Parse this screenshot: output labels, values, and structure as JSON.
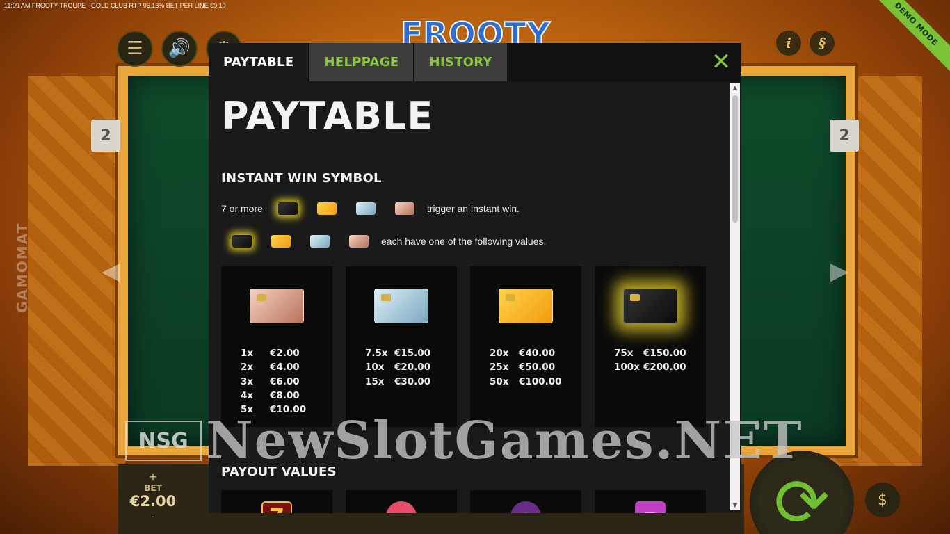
{
  "status_bar": "11:09 AM  FROOTY TROUPE - GOLD CLUB  RTP 96.13%  BET PER LINE €0.10",
  "demo_mode": "DEMO MODE",
  "game_logo": "FROOTY TROUPE",
  "vendor": "GAMOMAT",
  "line_marker_left": "2",
  "line_marker_right": "2",
  "bet": {
    "plus": "+",
    "label": "BET",
    "value": "€2.00",
    "minus": "-"
  },
  "watermark": {
    "badge": "NSG",
    "text": "NewSlotGames.NET"
  },
  "modal": {
    "tabs": [
      {
        "label": "PAYTABLE",
        "active": true
      },
      {
        "label": "HELPPAGE",
        "active": false
      },
      {
        "label": "HISTORY",
        "active": false
      }
    ],
    "close": "✕",
    "page_title": "PAYTABLE",
    "instant_win": {
      "title": "INSTANT WIN SYMBOL",
      "row1_lead": "7 or more",
      "row1_tail": "trigger an instant win.",
      "row2_tail": "each have one of the following values."
    },
    "value_cards": [
      {
        "card": "bronze",
        "rows": [
          {
            "mult": "1x",
            "amt": "€2.00"
          },
          {
            "mult": "2x",
            "amt": "€4.00"
          },
          {
            "mult": "3x",
            "amt": "€6.00"
          },
          {
            "mult": "4x",
            "amt": "€8.00"
          },
          {
            "mult": "5x",
            "amt": "€10.00"
          }
        ]
      },
      {
        "card": "silver",
        "rows": [
          {
            "mult": "7.5x",
            "amt": "€15.00"
          },
          {
            "mult": "10x",
            "amt": "€20.00"
          },
          {
            "mult": "15x",
            "amt": "€30.00"
          }
        ]
      },
      {
        "card": "gold",
        "rows": [
          {
            "mult": "20x",
            "amt": "€40.00"
          },
          {
            "mult": "25x",
            "amt": "€50.00"
          },
          {
            "mult": "50x",
            "amt": "€100.00"
          }
        ]
      },
      {
        "card": "black",
        "rows": [
          {
            "mult": "75x",
            "amt": "€150.00"
          },
          {
            "mult": "100x",
            "amt": "€200.00"
          }
        ]
      }
    ],
    "payout_values": {
      "title": "PAYOUT VALUES",
      "symbols": [
        "seven",
        "watermelon",
        "grape",
        "gift-box"
      ]
    }
  },
  "colors": {
    "accent_green": "#8cc63f",
    "modal_bg": "#1a1a1a",
    "card_bg": "#0a0a0a",
    "tab_inactive_bg": "#3c3c3c"
  }
}
